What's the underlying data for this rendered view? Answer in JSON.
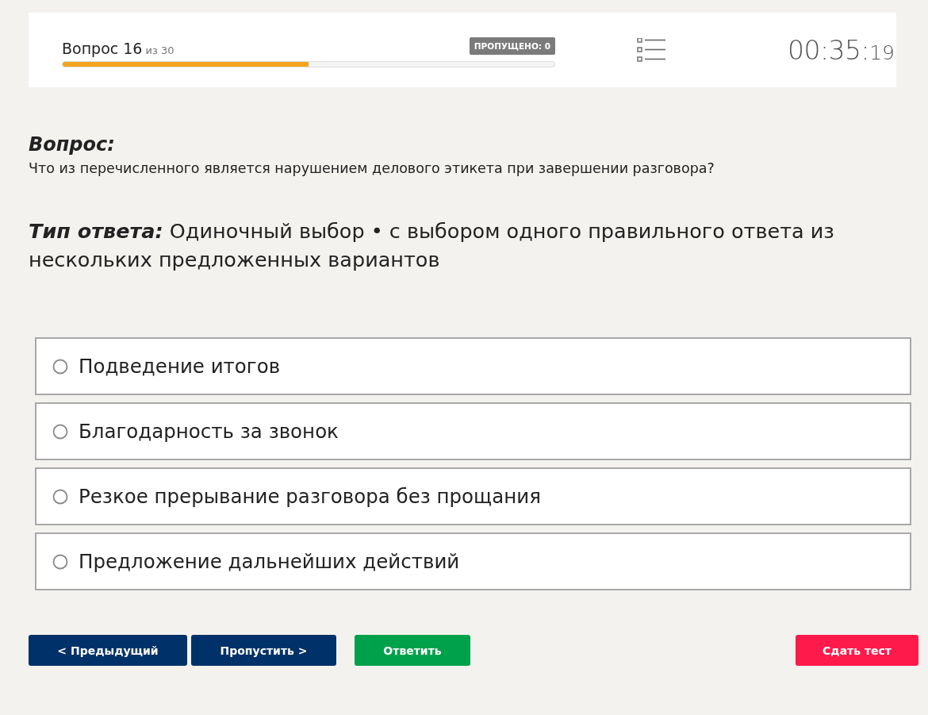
{
  "header": {
    "title": "Вопрос 16",
    "counter": "из 30",
    "progress": {
      "level": 0.5
    },
    "skipped_badge": "ПРОПУЩЕНО: 0",
    "timer": {
      "main": "00:35:",
      "seconds": "19"
    }
  },
  "question": {
    "heading": "Вопрос:",
    "text": "Что из перечисленного является нарушением делового этикета при завершении разговора?"
  },
  "answer_type": {
    "text": "**Тип ответа:** Одиночный выбор • с выбором одного правильного ответа из нескольких предложенных вариантов"
  },
  "options": [
    {
      "label": "Подведение итогов",
      "selected": false
    },
    {
      "label": "Благодарность за звонок",
      "selected": false
    },
    {
      "label": "Резкое прерывание разговора без прощания",
      "selected": false
    },
    {
      "label": "Предложение дальнейших действий",
      "selected": false
    }
  ],
  "buttons": [
    {
      "label": "< Предыдущий",
      "kind": "nav"
    },
    {
      "label": "Пропустить >",
      "kind": "nav"
    },
    {
      "label": "Ответить",
      "kind": "primary"
    },
    {
      "label": "Сдать тест",
      "kind": "danger"
    }
  ]
}
